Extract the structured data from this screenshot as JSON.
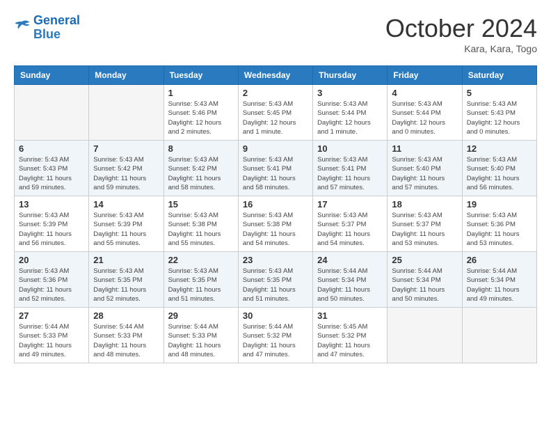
{
  "header": {
    "logo": {
      "line1": "General",
      "line2": "Blue"
    },
    "title": "October 2024",
    "location": "Kara, Kara, Togo"
  },
  "calendar": {
    "days_of_week": [
      "Sunday",
      "Monday",
      "Tuesday",
      "Wednesday",
      "Thursday",
      "Friday",
      "Saturday"
    ],
    "weeks": [
      [
        {
          "day": "",
          "empty": true
        },
        {
          "day": "",
          "empty": true
        },
        {
          "day": "1",
          "sunrise": "Sunrise: 5:43 AM",
          "sunset": "Sunset: 5:46 PM",
          "daylight": "Daylight: 12 hours and 2 minutes."
        },
        {
          "day": "2",
          "sunrise": "Sunrise: 5:43 AM",
          "sunset": "Sunset: 5:45 PM",
          "daylight": "Daylight: 12 hours and 1 minute."
        },
        {
          "day": "3",
          "sunrise": "Sunrise: 5:43 AM",
          "sunset": "Sunset: 5:44 PM",
          "daylight": "Daylight: 12 hours and 1 minute."
        },
        {
          "day": "4",
          "sunrise": "Sunrise: 5:43 AM",
          "sunset": "Sunset: 5:44 PM",
          "daylight": "Daylight: 12 hours and 0 minutes."
        },
        {
          "day": "5",
          "sunrise": "Sunrise: 5:43 AM",
          "sunset": "Sunset: 5:43 PM",
          "daylight": "Daylight: 12 hours and 0 minutes."
        }
      ],
      [
        {
          "day": "6",
          "sunrise": "Sunrise: 5:43 AM",
          "sunset": "Sunset: 5:43 PM",
          "daylight": "Daylight: 11 hours and 59 minutes."
        },
        {
          "day": "7",
          "sunrise": "Sunrise: 5:43 AM",
          "sunset": "Sunset: 5:42 PM",
          "daylight": "Daylight: 11 hours and 59 minutes."
        },
        {
          "day": "8",
          "sunrise": "Sunrise: 5:43 AM",
          "sunset": "Sunset: 5:42 PM",
          "daylight": "Daylight: 11 hours and 58 minutes."
        },
        {
          "day": "9",
          "sunrise": "Sunrise: 5:43 AM",
          "sunset": "Sunset: 5:41 PM",
          "daylight": "Daylight: 11 hours and 58 minutes."
        },
        {
          "day": "10",
          "sunrise": "Sunrise: 5:43 AM",
          "sunset": "Sunset: 5:41 PM",
          "daylight": "Daylight: 11 hours and 57 minutes."
        },
        {
          "day": "11",
          "sunrise": "Sunrise: 5:43 AM",
          "sunset": "Sunset: 5:40 PM",
          "daylight": "Daylight: 11 hours and 57 minutes."
        },
        {
          "day": "12",
          "sunrise": "Sunrise: 5:43 AM",
          "sunset": "Sunset: 5:40 PM",
          "daylight": "Daylight: 11 hours and 56 minutes."
        }
      ],
      [
        {
          "day": "13",
          "sunrise": "Sunrise: 5:43 AM",
          "sunset": "Sunset: 5:39 PM",
          "daylight": "Daylight: 11 hours and 56 minutes."
        },
        {
          "day": "14",
          "sunrise": "Sunrise: 5:43 AM",
          "sunset": "Sunset: 5:39 PM",
          "daylight": "Daylight: 11 hours and 55 minutes."
        },
        {
          "day": "15",
          "sunrise": "Sunrise: 5:43 AM",
          "sunset": "Sunset: 5:38 PM",
          "daylight": "Daylight: 11 hours and 55 minutes."
        },
        {
          "day": "16",
          "sunrise": "Sunrise: 5:43 AM",
          "sunset": "Sunset: 5:38 PM",
          "daylight": "Daylight: 11 hours and 54 minutes."
        },
        {
          "day": "17",
          "sunrise": "Sunrise: 5:43 AM",
          "sunset": "Sunset: 5:37 PM",
          "daylight": "Daylight: 11 hours and 54 minutes."
        },
        {
          "day": "18",
          "sunrise": "Sunrise: 5:43 AM",
          "sunset": "Sunset: 5:37 PM",
          "daylight": "Daylight: 11 hours and 53 minutes."
        },
        {
          "day": "19",
          "sunrise": "Sunrise: 5:43 AM",
          "sunset": "Sunset: 5:36 PM",
          "daylight": "Daylight: 11 hours and 53 minutes."
        }
      ],
      [
        {
          "day": "20",
          "sunrise": "Sunrise: 5:43 AM",
          "sunset": "Sunset: 5:36 PM",
          "daylight": "Daylight: 11 hours and 52 minutes."
        },
        {
          "day": "21",
          "sunrise": "Sunrise: 5:43 AM",
          "sunset": "Sunset: 5:35 PM",
          "daylight": "Daylight: 11 hours and 52 minutes."
        },
        {
          "day": "22",
          "sunrise": "Sunrise: 5:43 AM",
          "sunset": "Sunset: 5:35 PM",
          "daylight": "Daylight: 11 hours and 51 minutes."
        },
        {
          "day": "23",
          "sunrise": "Sunrise: 5:43 AM",
          "sunset": "Sunset: 5:35 PM",
          "daylight": "Daylight: 11 hours and 51 minutes."
        },
        {
          "day": "24",
          "sunrise": "Sunrise: 5:44 AM",
          "sunset": "Sunset: 5:34 PM",
          "daylight": "Daylight: 11 hours and 50 minutes."
        },
        {
          "day": "25",
          "sunrise": "Sunrise: 5:44 AM",
          "sunset": "Sunset: 5:34 PM",
          "daylight": "Daylight: 11 hours and 50 minutes."
        },
        {
          "day": "26",
          "sunrise": "Sunrise: 5:44 AM",
          "sunset": "Sunset: 5:34 PM",
          "daylight": "Daylight: 11 hours and 49 minutes."
        }
      ],
      [
        {
          "day": "27",
          "sunrise": "Sunrise: 5:44 AM",
          "sunset": "Sunset: 5:33 PM",
          "daylight": "Daylight: 11 hours and 49 minutes."
        },
        {
          "day": "28",
          "sunrise": "Sunrise: 5:44 AM",
          "sunset": "Sunset: 5:33 PM",
          "daylight": "Daylight: 11 hours and 48 minutes."
        },
        {
          "day": "29",
          "sunrise": "Sunrise: 5:44 AM",
          "sunset": "Sunset: 5:33 PM",
          "daylight": "Daylight: 11 hours and 48 minutes."
        },
        {
          "day": "30",
          "sunrise": "Sunrise: 5:44 AM",
          "sunset": "Sunset: 5:32 PM",
          "daylight": "Daylight: 11 hours and 47 minutes."
        },
        {
          "day": "31",
          "sunrise": "Sunrise: 5:45 AM",
          "sunset": "Sunset: 5:32 PM",
          "daylight": "Daylight: 11 hours and 47 minutes."
        },
        {
          "day": "",
          "empty": true
        },
        {
          "day": "",
          "empty": true
        }
      ]
    ]
  }
}
